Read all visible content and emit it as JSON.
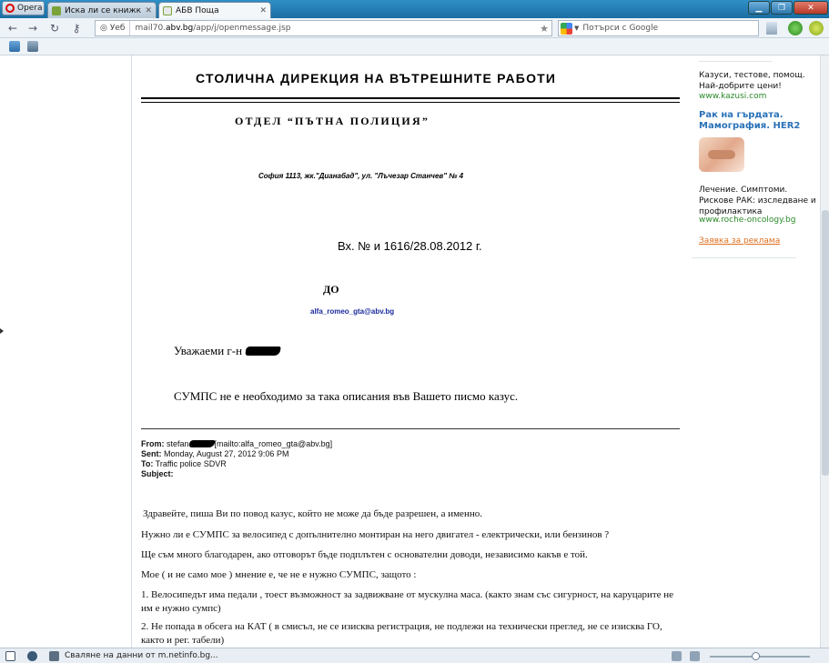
{
  "browser": {
    "menu_label": "Opera",
    "tabs": [
      {
        "label": "Иска ли се книжка за ...",
        "active": false
      },
      {
        "label": "АБВ Поща",
        "active": true
      }
    ],
    "window_controls": [
      "minimize",
      "restore",
      "close"
    ],
    "address": {
      "badge": "Уеб",
      "url_prefix": "mail70.",
      "url_domain": "abv.bg",
      "url_path": "/app/j/openmessage.jsp"
    },
    "search": {
      "placeholder": "Потърси с Google"
    }
  },
  "letter": {
    "heading": "СТОЛИЧНА  ДИРЕКЦИЯ  НА  ВЪТРЕШНИТЕ  РАБОТИ",
    "department": "ОТДЕЛ “ПЪТНА ПОЛИЦИЯ”",
    "address": "София 1113, жк.\"Дианабад\", ул. \"Лъчезар Станчев\" № 4",
    "reference": "Вх. № и 1616/28.08.2012 г.",
    "to_label": "ДО",
    "to_email": "alfa_romeo_gta@abv.bg",
    "greeting": "Уважаеми г-н",
    "body": "СУМПС не е необходимо за така описания във Вашето писмо казус."
  },
  "quoted": {
    "from_label": "From:",
    "from_name": "stefan",
    "from_email": "[mailto:alfa_romeo_gta@abv.bg]",
    "sent_label": "Sent:",
    "sent_value": "Monday, August 27, 2012 9:06 PM",
    "to_label": "To:",
    "to_value": "Traffic police SDVR",
    "subject_label": "Subject:",
    "paragraphs": [
      "Здравейте, пиша Ви по повод казус, който не може да бъде разрешен, а именно.",
      "Нужно ли е СУМПС  за велосипед с допълнително монтиран на него двигател - електрически, или бензинов ?",
      "Ще съм много благодарен, ако отговорът бъде подплътен с основателни доводи, независимо какъв е той.",
      "Мое ( и не само мое ) мнение е, че не е нужно СУМПС, защото :",
      "1. Велосипедът има педали , тоест възможност за задвижване от мускулна маса. (както знам със сигурност, на каруцарите не им е нужно сумпс)",
      "2. Не попада в обсега на КАТ ( в смисъл, не се изисква регистрация, не подлежи на технически преглед, не се изисква ГО, както и рег. табели)"
    ]
  },
  "ads": {
    "ad1_lines": [
      "Казуси, тестове, помощ.",
      "Най-добрите цени!"
    ],
    "ad1_link": "www.kazusi.com",
    "ad2_title": [
      "Рак на гърдата.",
      "Мамография. HER2"
    ],
    "ad2_lines": [
      "Лечение. Симптоми.",
      "Рискове РАК: изследване и",
      "профилактика"
    ],
    "ad2_link": "www.roche-oncology.bg",
    "order_link": "Заявка за реклама"
  },
  "status": {
    "text": "Сваляне на данни от m.netinfo.bg..."
  },
  "colors": {
    "tabbar": "#1b6ea3",
    "link_green": "#2a8a2a",
    "ad_title_blue": "#2a72b8",
    "order_orange": "#e07020",
    "email_blue": "#1a2a9a"
  }
}
